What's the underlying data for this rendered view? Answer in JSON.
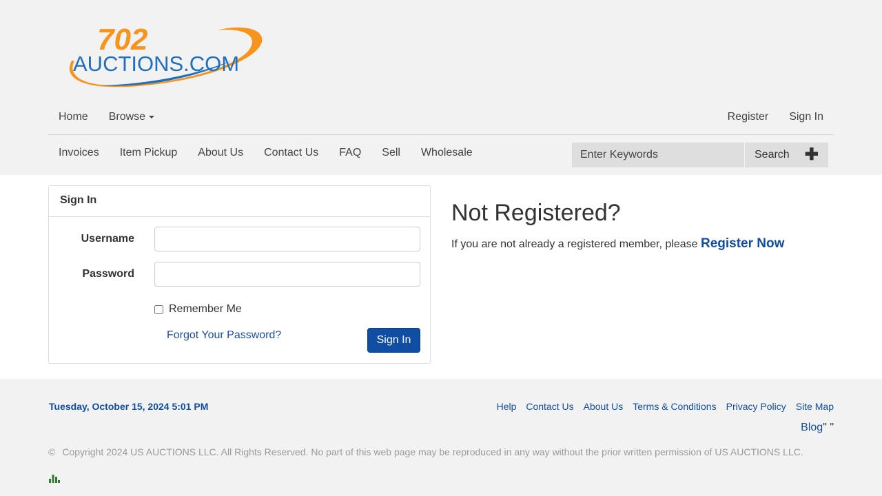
{
  "logo": {
    "top_text": "702",
    "main_text": "AUCTIONS.COM"
  },
  "topnav": {
    "left": [
      "Home",
      "Browse"
    ],
    "right": [
      "Register",
      "Sign In"
    ]
  },
  "subnav": [
    "Invoices",
    "Item Pickup",
    "About Us",
    "Contact Us",
    "FAQ",
    "Sell",
    "Wholesale"
  ],
  "search": {
    "placeholder": "Enter Keywords",
    "button_label": "Search",
    "plus": "✚"
  },
  "signin_panel": {
    "title": "Sign In",
    "username_label": "Username",
    "password_label": "Password",
    "remember_label": "Remember Me",
    "forgot_link": "Forgot Your Password?",
    "submit_label": "Sign In"
  },
  "register_promo": {
    "heading": "Not Registered?",
    "text": "If you are not already a registered member, please ",
    "link": "Register Now"
  },
  "footer": {
    "date": "Tuesday, October 15, 2024 5:01 PM",
    "links": [
      "Help",
      "Contact Us",
      "About Us",
      "Terms & Conditions",
      "Privacy Policy",
      "Site Map"
    ],
    "blog": "Blog",
    "blog_trail": "\" \"",
    "copyright_symbol": "©",
    "copyright": "Copyright 2024 US AUCTIONS LLC. All Rights Reserved. No part of this web page may be reproduced in any way without the prior written permission of US AUCTIONS LLC."
  },
  "colors": {
    "brand_blue": "#0f4ea3",
    "brand_orange": "#f7941d",
    "header_bg": "#f2f2f2"
  }
}
